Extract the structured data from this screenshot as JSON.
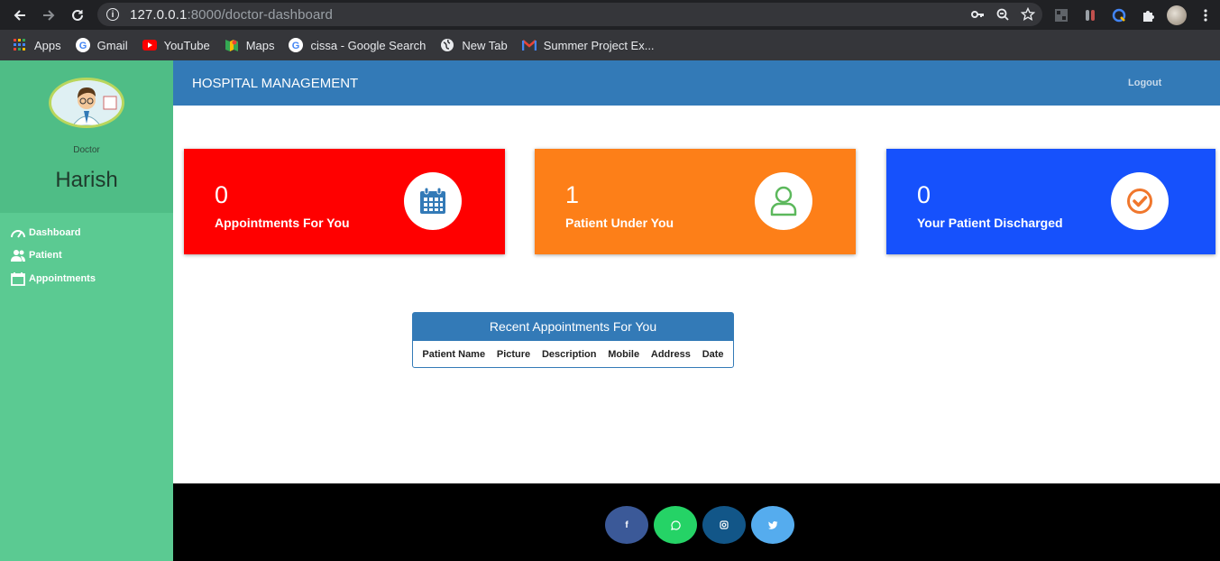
{
  "browser": {
    "url_host": "127.0.0.1",
    "url_rest": ":8000/doctor-dashboard",
    "bookmarks": [
      {
        "label": "Apps",
        "icon": "apps-grid-icon"
      },
      {
        "label": "Gmail",
        "icon": "google-icon"
      },
      {
        "label": "YouTube",
        "icon": "youtube-icon"
      },
      {
        "label": "Maps",
        "icon": "maps-icon"
      },
      {
        "label": "cissa - Google Search",
        "icon": "google-icon"
      },
      {
        "label": "New Tab",
        "icon": "globe-icon"
      },
      {
        "label": "Summer Project Ex...",
        "icon": "gmail-icon"
      }
    ]
  },
  "sidebar": {
    "role": "Doctor",
    "name": "Harish",
    "items": [
      {
        "label": "Dashboard",
        "icon": "speedometer-icon"
      },
      {
        "label": "Patient",
        "icon": "users-icon"
      },
      {
        "label": "Appointments",
        "icon": "calendar-icon"
      }
    ]
  },
  "header": {
    "brand": "HOSPITAL MANAGEMENT",
    "logout": "Logout"
  },
  "cards": [
    {
      "value": "0",
      "label": "Appointments For You",
      "color": "#ff0000",
      "icon": "calendar-icon",
      "icon_color": "#337ab7"
    },
    {
      "value": "1",
      "label": "Patient Under You",
      "color": "#fd7f18",
      "icon": "user-icon",
      "icon_color": "#5cb85c"
    },
    {
      "value": "0",
      "label": "Your Patient Discharged",
      "color": "#1651fc",
      "icon": "check-circle-icon",
      "icon_color": "#f0772d"
    }
  ],
  "recent": {
    "title": "Recent Appointments For You",
    "columns": [
      "Patient Name",
      "Picture",
      "Description",
      "Mobile",
      "Address",
      "Date"
    ]
  },
  "footer": {
    "social": [
      {
        "label": "f",
        "icon": "facebook-icon",
        "color": "#3b5998"
      },
      {
        "label": "",
        "icon": "whatsapp-icon",
        "color": "#25d366"
      },
      {
        "label": "",
        "icon": "instagram-icon",
        "color": "#125688"
      },
      {
        "label": "",
        "icon": "twitter-icon",
        "color": "#55acee"
      }
    ]
  }
}
